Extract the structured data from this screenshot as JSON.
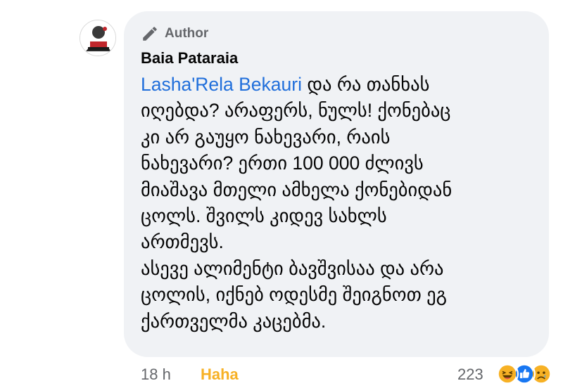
{
  "comment": {
    "author_badge": "Author",
    "name": "Baia Pataraia",
    "mention": "Lasha'Rela Bekauri",
    "text_lines": [
      " და რა თანხას",
      "იღებდა? არაფერს, ნულს! ქონებაც",
      "კი არ გაუყო ნახევარი, რაის",
      "ნახევარი? ერთი 100 000 ძლივს",
      "მიაშავა მთელი ამხელა ქონებიდან",
      "ცოლს. შვილს კიდევ სახლს",
      "ართმევს.",
      "ასევე ალიმენტი ბავშვისაა და არა",
      "ცოლის, იქნებ ოდესმე შეიგნოთ ეგ",
      "ქართველმა კაცებმა."
    ]
  },
  "footer": {
    "time": "18 h",
    "reaction_label": "Haha",
    "reaction_count": "223",
    "reactions": [
      "haha-icon",
      "like-icon",
      "sad-icon"
    ]
  },
  "colors": {
    "bubble_bg": "#f0f2f5",
    "mention": "#216fdb",
    "haha_label": "#f7b125",
    "secondary_text": "#65676b"
  }
}
